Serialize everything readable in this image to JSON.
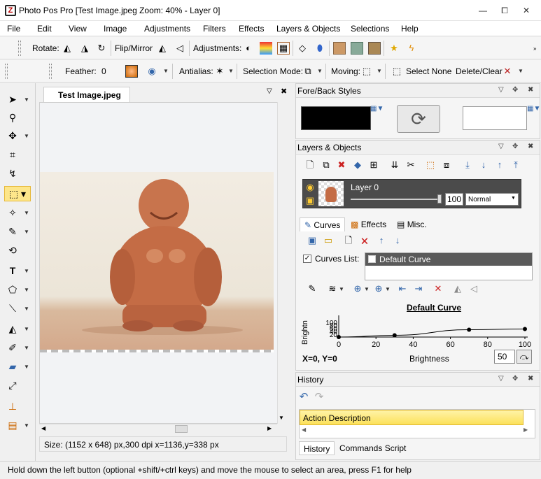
{
  "window": {
    "title": "Photo Pos Pro [Test Image.jpeg Zoom: 40% - Layer 0]",
    "controls": [
      "—",
      "⧠",
      "✕"
    ]
  },
  "menu": [
    "File",
    "Edit",
    "View",
    "Image",
    "Adjustments",
    "Filters",
    "Effects",
    "Layers & Objects",
    "Selections",
    "Help"
  ],
  "toolbar1": {
    "rotate_label": "Rotate:",
    "flip_label": "Flip/Mirror",
    "adjustments_label": "Adjustments:"
  },
  "toolbar2": {
    "feather_label": "Feather:",
    "feather_value": "0",
    "antialias_label": "Antialias:",
    "selection_mode_label": "Selection Mode:",
    "moving_label": "Moving:",
    "select_none_label": "Select None",
    "delete_clear_label": "Delete/Clear"
  },
  "document": {
    "tab_title": "Test Image.jpeg",
    "status_text": "Size: (1152 x 648) px,300 dpi  x=1136,y=338 px"
  },
  "fore_back": {
    "title": "Fore/Back Styles",
    "fore_color": "#000000",
    "back_color": "#ffffff"
  },
  "layers": {
    "title": "Layers & Objects",
    "layer_name": "Layer 0",
    "opacity": "100",
    "blend_mode": "Normal",
    "tabs": [
      "Curves",
      "Effects",
      "Misc."
    ],
    "curves_list_label": "Curves List:",
    "curve_item": "Default Curve",
    "curve_title": "Default Curve",
    "x_ticks": [
      "0",
      "20",
      "40",
      "60",
      "80",
      "100"
    ],
    "y_ticks": [
      "100",
      "80",
      "60",
      "40",
      "20"
    ],
    "x_axis_label": "Brightness",
    "y_axis_label": "Brightn",
    "coord_readout": "X=0, Y=0",
    "curve_value": "50"
  },
  "chart_data": {
    "type": "line",
    "x": [
      0,
      30,
      70,
      100
    ],
    "values": [
      0,
      12,
      50,
      55
    ],
    "xlabel": "Brightness",
    "ylabel": "Brightn",
    "title": "Default Curve",
    "xlim": [
      0,
      100
    ],
    "ylim": [
      0,
      100
    ]
  },
  "history": {
    "title": "History",
    "column_header": "Action Description",
    "tabs": [
      "History",
      "Commands Script"
    ]
  },
  "statusbar": {
    "text": "Hold down the left button (optional +shift/+ctrl keys) and move the mouse to select an area, press F1 for help"
  }
}
